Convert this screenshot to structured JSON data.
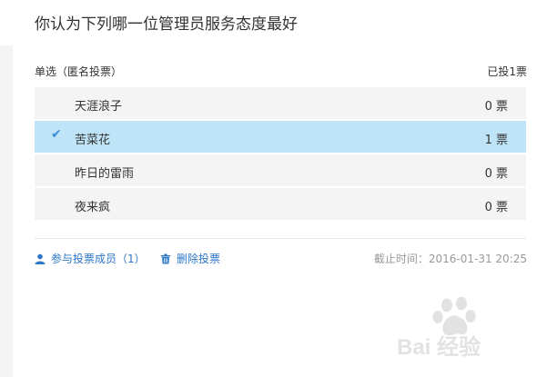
{
  "poll": {
    "title": "你认为下列哪一位管理员服务态度最好",
    "mode_label": "单选（匿名投票）",
    "voted_label": "已投1票",
    "options": [
      {
        "label": "天涯浪子",
        "count": "0 票",
        "selected": false
      },
      {
        "label": "苦菜花",
        "count": "1 票",
        "selected": true
      },
      {
        "label": "昨日的雷雨",
        "count": "0 票",
        "selected": false
      },
      {
        "label": "夜来疯",
        "count": "0 票",
        "selected": false
      }
    ]
  },
  "footer": {
    "members_label": "参与投票成员（1）",
    "delete_label": "删除投票",
    "deadline": "截止时间：2016-01-31 20:25",
    "icons": {
      "members": "user-icon",
      "delete": "trash-icon"
    }
  },
  "watermark": {
    "text": "Bai 经验"
  },
  "colors": {
    "accent": "#2e77c8",
    "selected_bg": "#bfe4f7",
    "option_bg": "#f4f4f4"
  }
}
